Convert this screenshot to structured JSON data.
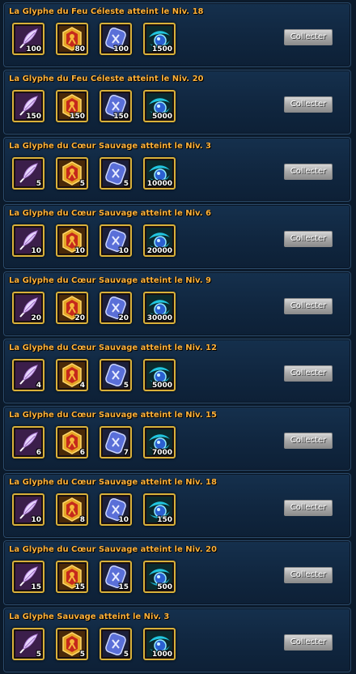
{
  "collect_label": "Collecter",
  "rows": [
    {
      "title": "La Glyphe du Feu Céleste atteint le Niv. 18",
      "items": [
        {
          "icon": "feather-icon",
          "qty": "100"
        },
        {
          "icon": "red-rune-icon",
          "qty": "80"
        },
        {
          "icon": "blue-rune-icon",
          "qty": "100"
        },
        {
          "icon": "blue-orb-icon",
          "qty": "1500"
        }
      ]
    },
    {
      "title": "La Glyphe du Feu Céleste atteint le Niv. 20",
      "items": [
        {
          "icon": "feather-icon",
          "qty": "150"
        },
        {
          "icon": "red-rune-icon",
          "qty": "150"
        },
        {
          "icon": "blue-rune-icon",
          "qty": "150"
        },
        {
          "icon": "blue-orb-icon",
          "qty": "5000"
        }
      ]
    },
    {
      "title": "La Glyphe du Cœur Sauvage atteint le Niv. 3",
      "items": [
        {
          "icon": "feather-icon",
          "qty": "5"
        },
        {
          "icon": "red-rune-icon",
          "qty": "5"
        },
        {
          "icon": "blue-rune-icon",
          "qty": "5"
        },
        {
          "icon": "blue-orb-icon",
          "qty": "10000"
        }
      ]
    },
    {
      "title": "La Glyphe du Cœur Sauvage atteint le Niv. 6",
      "items": [
        {
          "icon": "feather-icon",
          "qty": "10"
        },
        {
          "icon": "red-rune-icon",
          "qty": "10"
        },
        {
          "icon": "blue-rune-icon",
          "qty": "10"
        },
        {
          "icon": "blue-orb-icon",
          "qty": "20000"
        }
      ]
    },
    {
      "title": "La Glyphe du Cœur Sauvage atteint le Niv. 9",
      "items": [
        {
          "icon": "feather-icon",
          "qty": "20"
        },
        {
          "icon": "red-rune-icon",
          "qty": "20"
        },
        {
          "icon": "blue-rune-icon",
          "qty": "20"
        },
        {
          "icon": "blue-orb-icon",
          "qty": "30000"
        }
      ]
    },
    {
      "title": "La Glyphe du Cœur Sauvage atteint le Niv. 12",
      "items": [
        {
          "icon": "feather-icon",
          "qty": "4"
        },
        {
          "icon": "red-rune-icon",
          "qty": "4"
        },
        {
          "icon": "blue-rune-icon",
          "qty": "5"
        },
        {
          "icon": "blue-orb-icon",
          "qty": "5000"
        }
      ]
    },
    {
      "title": "La Glyphe du Cœur Sauvage atteint le Niv. 15",
      "items": [
        {
          "icon": "feather-icon",
          "qty": "6"
        },
        {
          "icon": "red-rune-icon",
          "qty": "6"
        },
        {
          "icon": "blue-rune-icon",
          "qty": "7"
        },
        {
          "icon": "blue-orb-icon",
          "qty": "7000"
        }
      ]
    },
    {
      "title": "La Glyphe du Cœur Sauvage atteint le Niv. 18",
      "items": [
        {
          "icon": "feather-icon",
          "qty": "10"
        },
        {
          "icon": "red-rune-icon",
          "qty": "8"
        },
        {
          "icon": "blue-rune-icon",
          "qty": "10"
        },
        {
          "icon": "blue-orb-icon",
          "qty": "150"
        }
      ]
    },
    {
      "title": "La Glyphe du Cœur Sauvage atteint le Niv. 20",
      "items": [
        {
          "icon": "feather-icon",
          "qty": "15"
        },
        {
          "icon": "red-rune-icon",
          "qty": "15"
        },
        {
          "icon": "blue-rune-icon",
          "qty": "15"
        },
        {
          "icon": "blue-orb-icon",
          "qty": "500"
        }
      ]
    },
    {
      "title": "La Glyphe Sauvage atteint le Niv. 3",
      "items": [
        {
          "icon": "feather-icon",
          "qty": "5"
        },
        {
          "icon": "red-rune-icon",
          "qty": "5"
        },
        {
          "icon": "blue-rune-icon",
          "qty": "5"
        },
        {
          "icon": "blue-orb-icon",
          "qty": "1000"
        }
      ]
    }
  ]
}
